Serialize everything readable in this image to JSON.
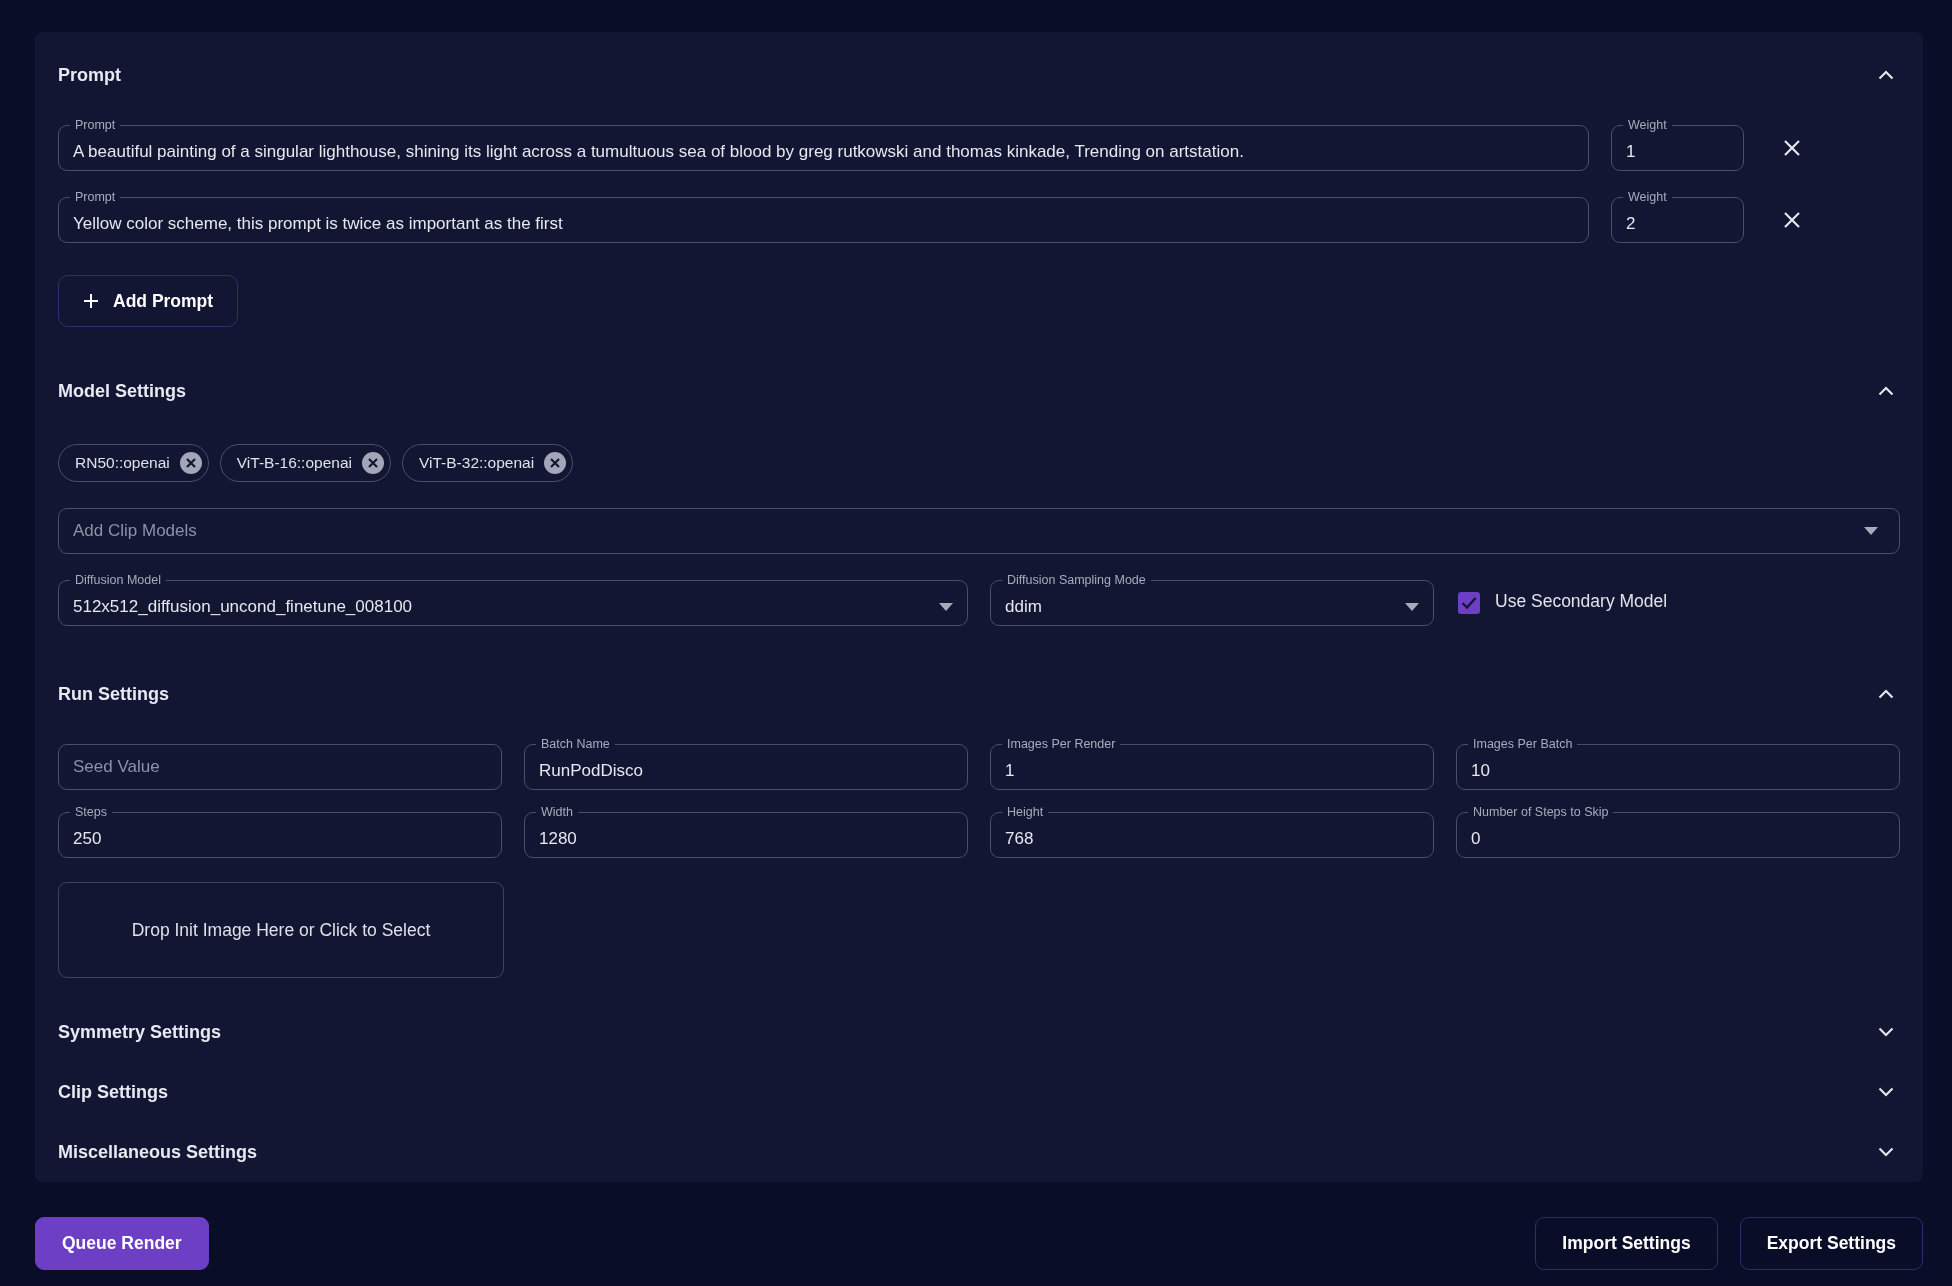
{
  "sections": [
    {
      "kind": "prompts",
      "title": "Prompt",
      "expanded": true,
      "prompts": [
        {
          "label": "Prompt",
          "value": "A beautiful painting of a singular lighthouse, shining its light across a tumultuous sea of blood by greg rutkowski and thomas kinkade, Trending on artstation.",
          "weight_label": "Weight",
          "weight": "1"
        },
        {
          "label": "Prompt",
          "value": "Yellow color scheme, this prompt is twice as important as the first",
          "weight_label": "Weight",
          "weight": "2"
        }
      ],
      "add_button": "Add Prompt"
    },
    {
      "kind": "model",
      "title": "Model Settings",
      "expanded": true,
      "chips": [
        "RN50::openai",
        "ViT-B-16::openai",
        "ViT-B-32::openai"
      ],
      "clip_field": {
        "placeholder": "Add Clip Models"
      },
      "diffusion_model": {
        "label": "Diffusion Model",
        "value": "512x512_diffusion_uncond_finetune_008100"
      },
      "sampling_mode": {
        "label": "Diffusion Sampling Mode",
        "value": "ddim"
      },
      "secondary_model": {
        "label": "Use Secondary Model",
        "checked": true
      }
    },
    {
      "kind": "run",
      "title": "Run Settings",
      "expanded": true,
      "fields": [
        {
          "placeholder": "Seed Value"
        },
        {
          "label": "Batch Name",
          "value": "RunPodDisco"
        },
        {
          "label": "Images Per Render",
          "value": "1"
        },
        {
          "label": "Images Per Batch",
          "value": "10"
        },
        {
          "label": "Steps",
          "value": "250"
        },
        {
          "label": "Width",
          "value": "1280"
        },
        {
          "label": "Height",
          "value": "768"
        },
        {
          "label": "Number of Steps to Skip",
          "value": "0"
        }
      ],
      "drop_zone": "Drop Init Image Here or Click to Select"
    },
    {
      "title": "Symmetry Settings",
      "expanded": false
    },
    {
      "title": "Clip Settings",
      "expanded": false
    },
    {
      "title": "Miscellaneous Settings",
      "expanded": false
    }
  ],
  "footer": {
    "primary_button": "Queue Render",
    "buttons": [
      "Import Settings",
      "Export Settings"
    ]
  }
}
